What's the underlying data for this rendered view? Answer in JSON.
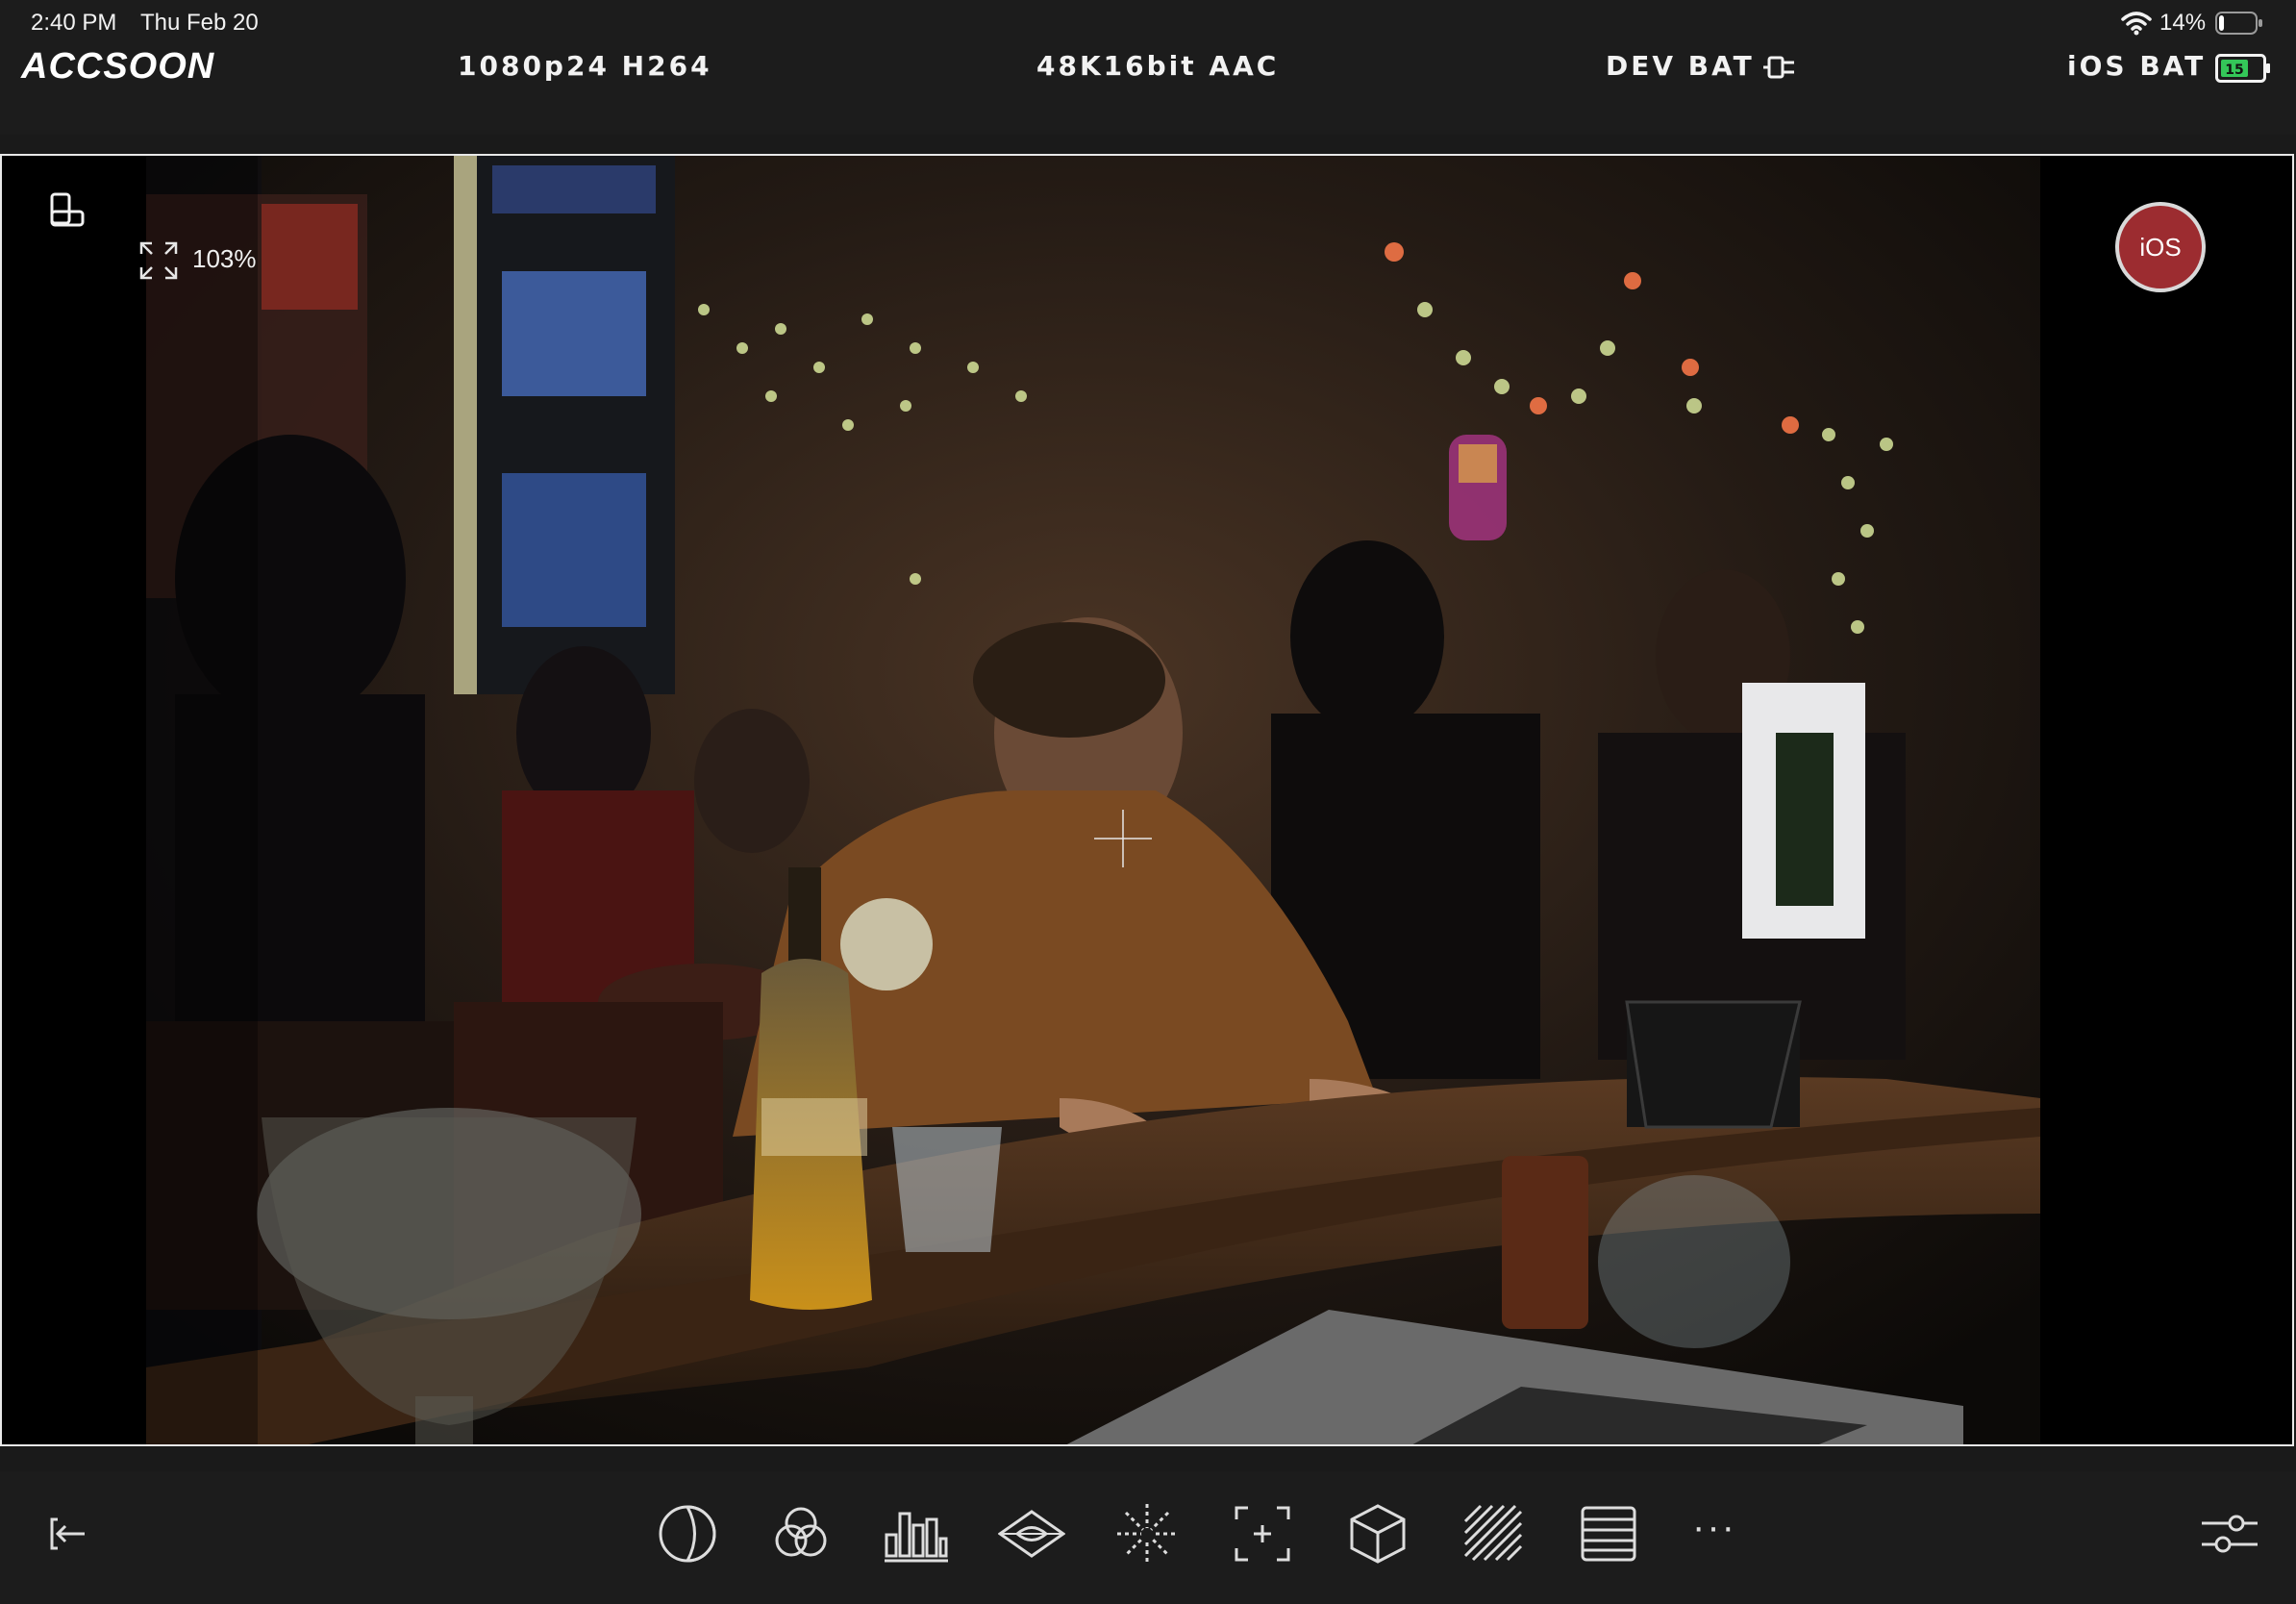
{
  "status_bar": {
    "time": "2:40 PM",
    "date": "Thu Feb 20",
    "battery_percent": "14%",
    "battery_level": 0.14
  },
  "header": {
    "logo": "ACCSOON",
    "video_format": "1080p24 H264",
    "audio_format": "48K16bit AAC",
    "device_battery_label": "DEV BAT",
    "ios_battery_label": "iOS BAT",
    "ios_battery_value": "15"
  },
  "viewer": {
    "zoom_level": "103%",
    "ios_badge": "iOS"
  },
  "toolbar": {
    "more_label": "···",
    "items": [
      "exit",
      "false-color",
      "rgb-parade",
      "histogram",
      "vectorscope",
      "focus-peaking",
      "frame-guide",
      "lut",
      "zebra",
      "waveform",
      "more",
      "settings"
    ]
  },
  "colors": {
    "bar_bg": "#1c1c1c",
    "badge_red": "#9c2c30",
    "battery_green": "#34c759"
  }
}
